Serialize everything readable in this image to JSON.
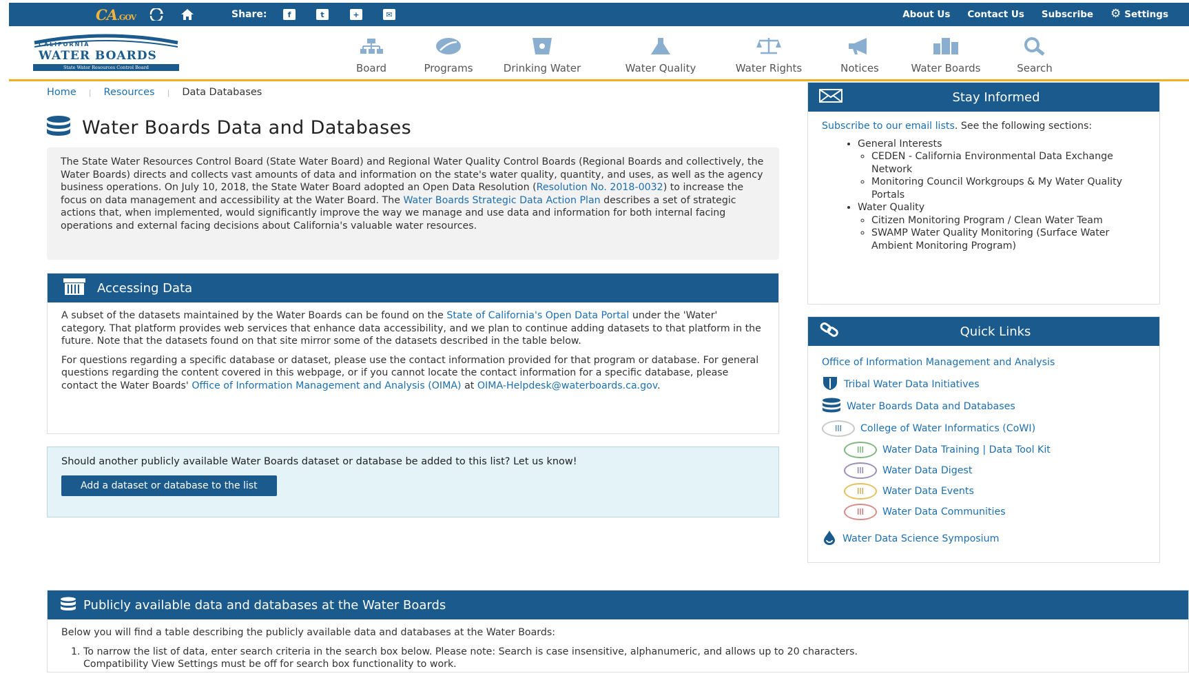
{
  "utility_bar": {
    "cagov_logo": "CA",
    "cagov_suffix": ".GOV",
    "share_label": "Share:",
    "links": [
      "About Us",
      "Contact Us",
      "Subscribe",
      "Settings"
    ]
  },
  "logo": {
    "state": "CALIFORNIA",
    "name": "WATER BOARDS",
    "subtitle": "State Water Resources Control Board"
  },
  "nav": {
    "items": [
      "Board",
      "Programs",
      "Drinking Water",
      "Water Quality",
      "Water Rights",
      "Notices",
      "Water Boards",
      "Search"
    ]
  },
  "breadcrumb": {
    "items": [
      "Home",
      "Resources",
      "Data Databases"
    ]
  },
  "page": {
    "title": "Water Boards Data and Databases"
  },
  "intro": {
    "text1": "The State Water Resources Control Board (State Water Board) and Regional Water Quality Control Boards (Regional Boards and collectively, the Water Boards) directs and collects vast amounts of data and information on the state's water quality, quantity, and uses, as well as the agency business operations. On July 10, 2018, the State Water Board adopted an Open Data Resolution (",
    "link1": "Resolution No. 2018-0032",
    "text2": ") to increase the focus on data management and accessibility at the Water Board. The ",
    "link2": "Water Boards Strategic Data Action Plan",
    "text3": " describes a set of strategic actions that, when implemented, would significantly improve the way we manage and use data and information for both internal facing operations and external facing decisions about California's valuable water resources."
  },
  "accessing": {
    "title": "Accessing Data",
    "p1_text1": "A subset of the datasets maintained by the Water Boards can be found on the ",
    "p1_link": "State of California's Open Data Portal",
    "p1_text2": " under the 'Water' category. That platform provides web services that enhance data accessibility, and we plan to continue adding datasets to that platform in the future. Note that the datasets found on that site mirror some of the datasets described in the table below.",
    "p2_text1": "For questions regarding a specific database or dataset, please use the contact information provided for that program or database. For general questions regarding the content covered in this webpage, or if you cannot locate the contact information for a specific database, please contact the Water Boards' ",
    "p2_link1": "Office of Information Management and Analysis (OIMA)",
    "p2_text2": " at ",
    "p2_link2": "OIMA-Helpdesk@waterboards.ca.gov",
    "p2_text3": "."
  },
  "callout": {
    "question": "Should another publicly available Water Boards dataset or database be added to this list? Let us know!",
    "button": "Add a dataset or database to the list"
  },
  "stay_informed": {
    "title": "Stay Informed",
    "intro_link": "Subscribe to our email lists",
    "intro_text": ". See the following sections:",
    "group1": "General Interests",
    "group1_items": [
      "CEDEN - California Environmental Data Exchange Network",
      "Monitoring Council Workgroups & My Water Quality Portals"
    ],
    "group2": "Water Quality",
    "group2_items": [
      "Citizen Monitoring Program / Clean Water Team",
      "SWAMP Water Quality Monitoring (Surface Water Ambient Monitoring Program)"
    ]
  },
  "quick_links": {
    "title": "Quick Links",
    "items": [
      "Office of Information Management and Analysis",
      "Tribal Water Data Initiatives",
      "Water Boards Data and Databases",
      "College of Water Informatics (CoWI)",
      "Water Data Training | Data Tool Kit",
      "Water Data Digest",
      "Water Data Events",
      "Water Data Communities",
      "Water Data Science Symposium"
    ]
  },
  "public_data": {
    "title": "Publicly available data and databases at the Water Boards",
    "intro": "Below you will find a table describing the publicly available data and databases at the Water Boards:",
    "step1": "To narrow the list of data, enter search criteria in the search box below. Please note: Search is case insensitive, alphanumeric, and allows up to 20 characters.",
    "step1_cont": "Compatibility View Settings must be off for search box functionality to work."
  },
  "colors": {
    "brand_blue": "#1a5a8c",
    "accent_gold": "#f2b01e",
    "link": "#1d6fb0",
    "callout_bg": "#e4f3f8"
  }
}
